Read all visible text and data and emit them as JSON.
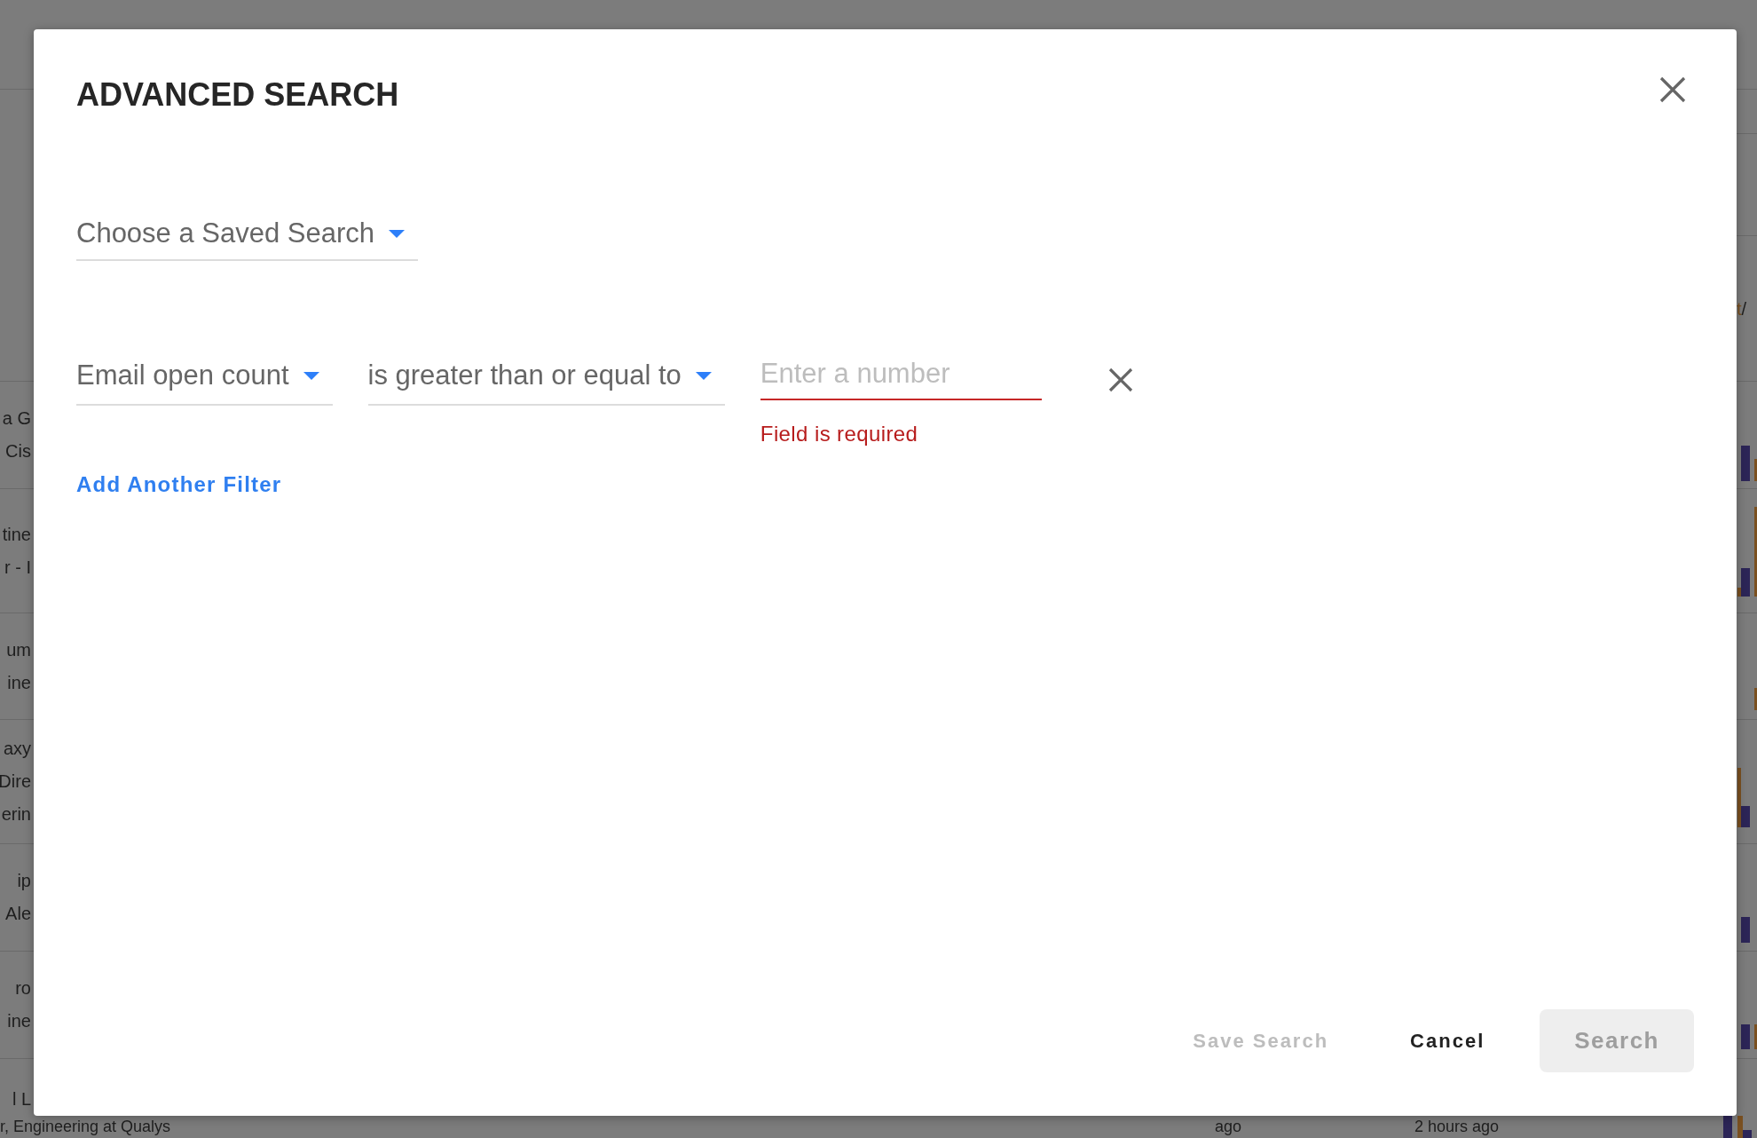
{
  "background": {
    "breadcrumb": [
      {
        "text": "t",
        "kind": "link"
      },
      {
        "text": "/",
        "kind": "separator"
      }
    ],
    "rows": [
      {
        "lines": [
          "a G",
          "Cis"
        ]
      },
      {
        "lines": [
          "tine",
          "r - I"
        ]
      },
      {
        "lines": [
          "um",
          "ine"
        ]
      },
      {
        "lines": [
          "axy",
          "Dire",
          "erin"
        ]
      },
      {
        "lines": [
          "ip",
          "Ale"
        ]
      },
      {
        "lines": [
          "ro",
          "ine"
        ]
      },
      {
        "lines": [
          "l L"
        ]
      }
    ],
    "bottom_texts": [
      "r, Engineering at Qualys",
      "ago",
      "2 hours ago"
    ]
  },
  "dialog": {
    "title": "ADVANCED SEARCH",
    "saved_search": {
      "prompt": "Choose a Saved Search"
    },
    "filters": [
      {
        "field": "Email open count",
        "operator": "is greater than or equal to",
        "value": {
          "placeholder": "Enter a number"
        },
        "error": "Field is required"
      }
    ],
    "add_filter": "Add Another Filter",
    "buttons": [
      {
        "label": "Save Search",
        "kind": "text",
        "disabled": true
      },
      {
        "label": "Cancel",
        "kind": "text",
        "disabled": false
      },
      {
        "label": "Search",
        "kind": "filled",
        "disabled": true
      }
    ]
  }
}
